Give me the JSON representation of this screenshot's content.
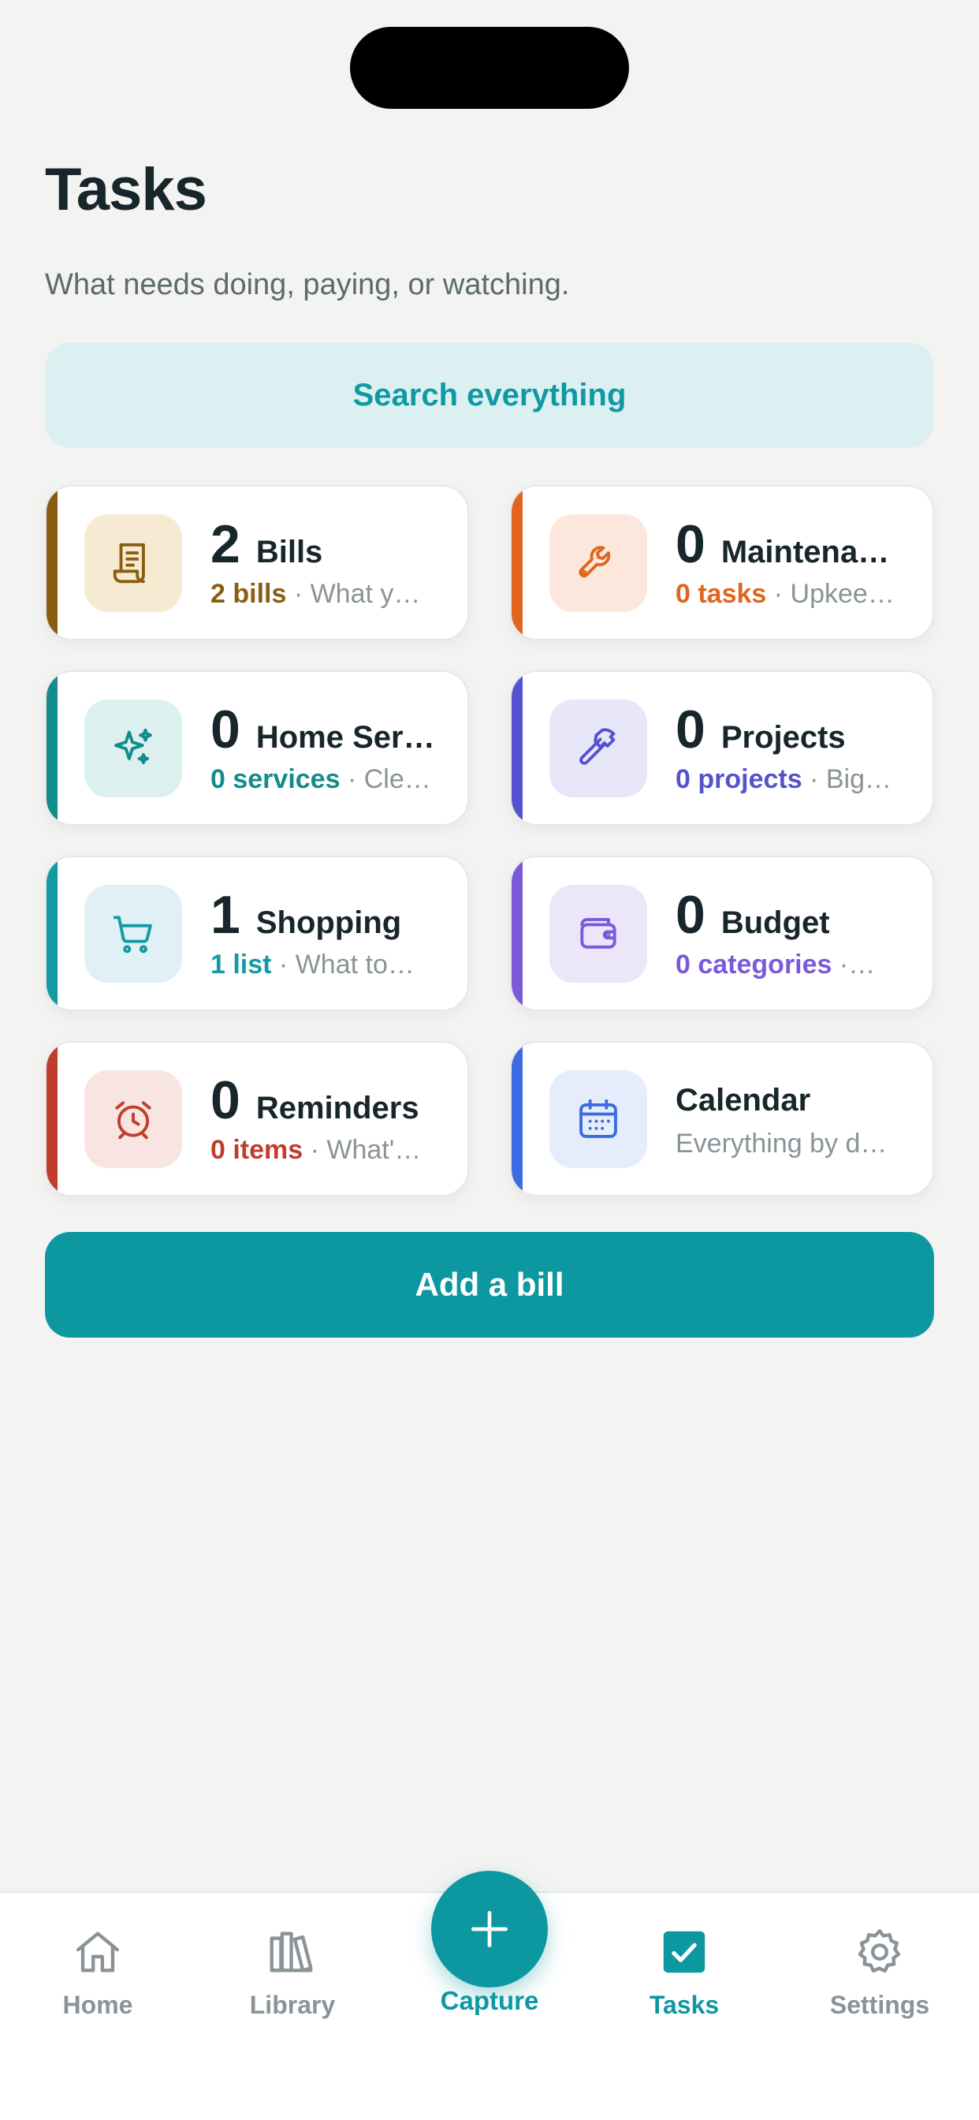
{
  "header": {
    "title": "Tasks",
    "subtitle": "What needs doing, paying, or watching."
  },
  "search": {
    "label": "Search everything"
  },
  "cards": [
    {
      "count": "2",
      "label": "Bills",
      "stat": "2 bills",
      "rest": " · What y…",
      "color": "#8a5e12",
      "bg": "#f7ead3",
      "icon": "receipt-icon"
    },
    {
      "count": "0",
      "label": "Maintena…",
      "stat": "0 tasks",
      "rest": " · Upkee…",
      "color": "#e0651e",
      "bg": "#fce7dc",
      "icon": "wrench-icon"
    },
    {
      "count": "0",
      "label": "Home Ser…",
      "stat": "0 services",
      "rest": " · Cle…",
      "color": "#138c8c",
      "bg": "#dcf0f0",
      "icon": "sparkles-icon"
    },
    {
      "count": "0",
      "label": "Projects",
      "stat": "0 projects",
      "rest": " · Big…",
      "color": "#5552cf",
      "bg": "#e8e7fa",
      "icon": "hammer-icon"
    },
    {
      "count": "1",
      "label": "Shopping",
      "stat": "1 list",
      "rest": " · What to…",
      "color": "#139aa4",
      "bg": "#dff1f4",
      "icon": "cart-icon"
    },
    {
      "count": "0",
      "label": "Budget",
      "stat": "0 categories",
      "rest": " ·…",
      "color": "#7b5ad9",
      "bg": "#ece6fa",
      "icon": "wallet-icon"
    },
    {
      "count": "0",
      "label": "Reminders",
      "stat": "0 items",
      "rest": " · What'…",
      "color": "#bf3d2c",
      "bg": "#f8e4e1",
      "icon": "alarm-clock-icon"
    },
    {
      "count": "",
      "label": "Calendar",
      "stat": "",
      "rest": "Everything by d…",
      "color": "#3d6be0",
      "bg": "#e5ecfb",
      "icon": "calendar-icon"
    }
  ],
  "actions": {
    "add_label": "Add a bill"
  },
  "tabbar": {
    "home": "Home",
    "library": "Library",
    "capture": "Capture",
    "tasks": "Tasks",
    "settings": "Settings",
    "active": "Tasks"
  },
  "colors": {
    "accent": "#0d98a1",
    "background": "#f3f4f2"
  }
}
